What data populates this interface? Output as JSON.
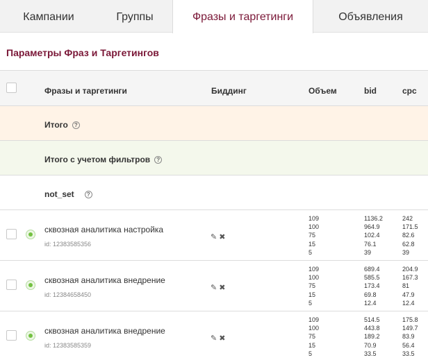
{
  "tabs": [
    "Кампании",
    "Группы",
    "Фразы и таргетинги",
    "Объявления"
  ],
  "active_tab": "Фразы и таргетинги",
  "section_title": "Параметры Фраз и Таргетингов",
  "columns": {
    "phrases": "Фразы и таргетинги",
    "bidding": "Биддинг",
    "volume": "Объем",
    "bid": "bid",
    "cpc": "cpc"
  },
  "summary": {
    "total": "Итого",
    "filtered": "Итого с учетом фильтров",
    "not_set": "not_set"
  },
  "help_glyph": "?",
  "icons": {
    "edit": "pencil-icon",
    "delete": "close-icon",
    "status": "status-active-icon"
  },
  "colors": {
    "accent": "#7a1737",
    "total_bg": "#fff3e7",
    "filtered_bg": "#f4f8ec",
    "status": "#74c142"
  },
  "rows": [
    {
      "phrase": "сквозная аналитика настройка",
      "id": "id: 12383585356",
      "volume": [
        "109",
        "100",
        "75",
        "15",
        "5"
      ],
      "bid": [
        "1136.2",
        "964.9",
        "102.4",
        "76.1",
        "39"
      ],
      "cpc": [
        "242",
        "171.5",
        "82.6",
        "62.8",
        "39"
      ]
    },
    {
      "phrase": "сквозная аналитика внедрение",
      "id": "id: 12384658450",
      "volume": [
        "109",
        "100",
        "75",
        "15",
        "5"
      ],
      "bid": [
        "689.4",
        "585.5",
        "173.4",
        "69.8",
        "12.4"
      ],
      "cpc": [
        "204.9",
        "167.3",
        "81",
        "47.9",
        "12.4"
      ]
    },
    {
      "phrase": "сквозная аналитика внедрение",
      "id": "id: 12383585359",
      "volume": [
        "109",
        "100",
        "75",
        "15",
        "5"
      ],
      "bid": [
        "514.5",
        "443.8",
        "189.2",
        "70.9",
        "33.5"
      ],
      "cpc": [
        "175.8",
        "149.7",
        "83.9",
        "56.4",
        "33.5"
      ]
    }
  ]
}
